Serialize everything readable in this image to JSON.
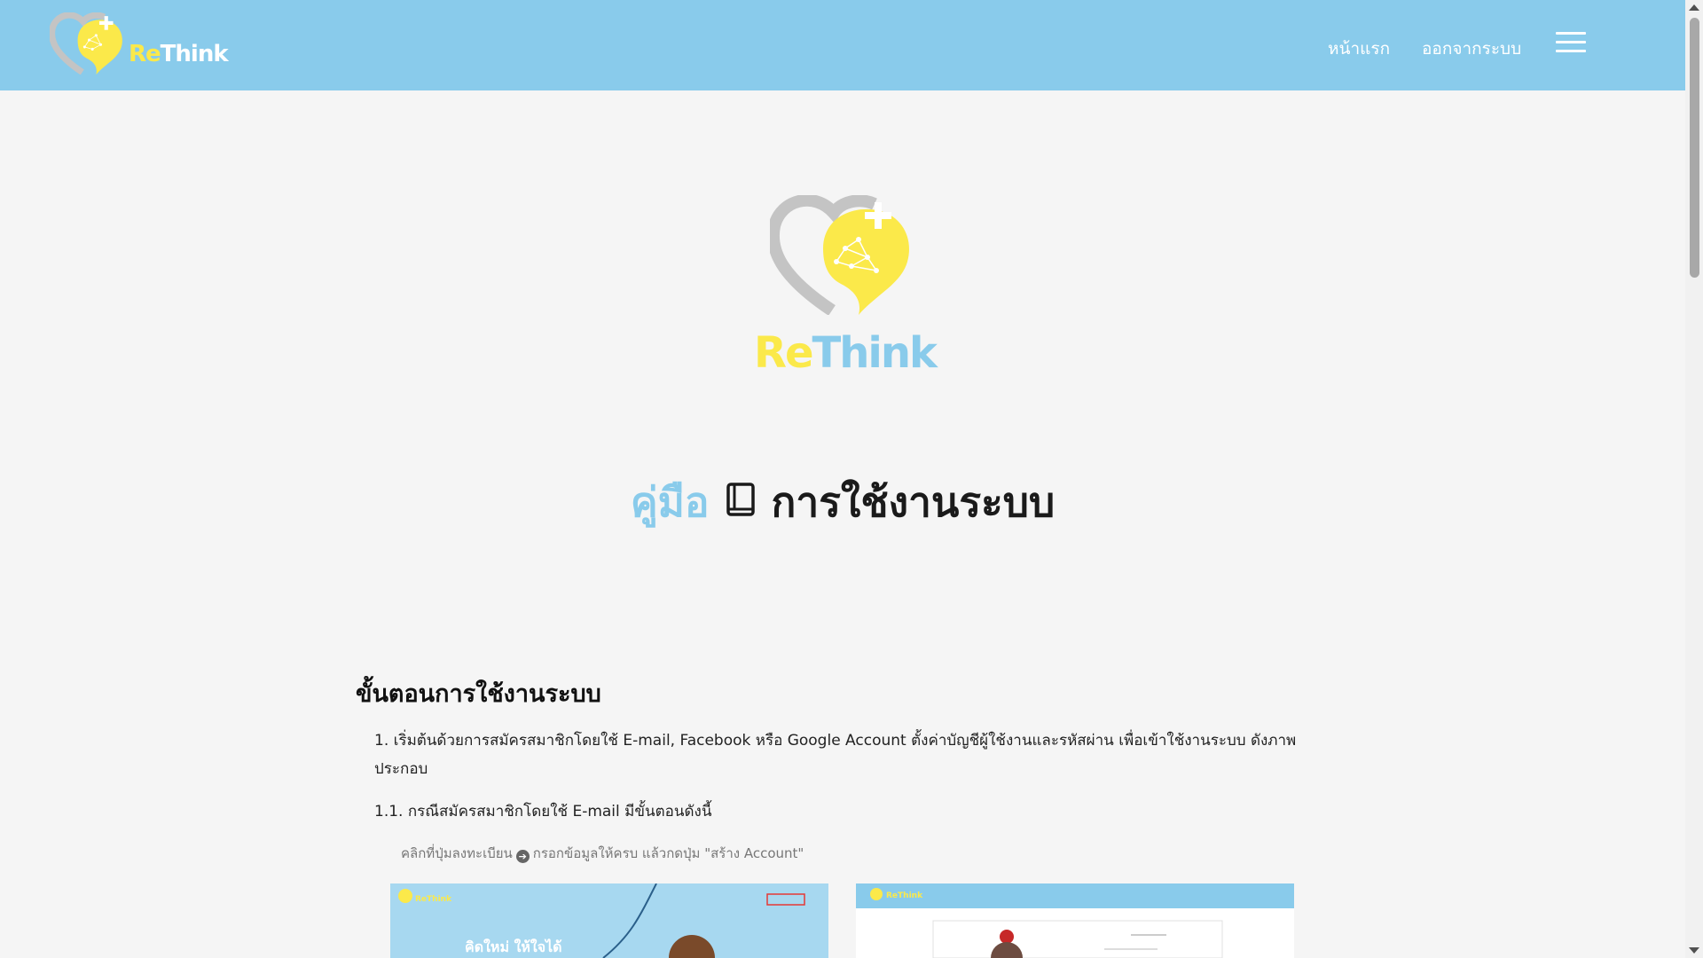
{
  "brand": {
    "name_part1": "Re",
    "name_part2": "Think",
    "colors": {
      "yellow": "#fbe94a",
      "blue": "#89cbeb",
      "gray": "#c4c4c4"
    }
  },
  "nav": {
    "home": "หน้าแรก",
    "logout": "ออกจากระบบ",
    "menu_icon": "hamburger-icon"
  },
  "hero": {
    "title_part1": "คู่มือ",
    "title_icon": "book-icon",
    "title_part2": "การใช้งานระบบ"
  },
  "content": {
    "heading": "ขั้นตอนการใช้งานระบบ",
    "step1": "1. เริ่มต้นด้วยการสมัครสมาชิกโดยใช้ E-mail, Facebook หรือ Google Account ตั้งค่าบัญชีผู้ใช้งานและรหัสผ่าน เพื่อเข้าใช้งานระบบ ดังภาพประกอบ",
    "step1_1": "1.1. กรณีสมัครสมาชิกโดยใช้ E-mail มีขั้นตอนดังนี้",
    "caption_part1": "คลิกที่ปุ่มลงทะเบียน",
    "caption_part2": "กรอกข้อมูลให้ครบ แล้วกดปุ่ม \"สร้าง Account\"",
    "shot1_banner": "คิดใหม่ ให้ใจได้"
  }
}
